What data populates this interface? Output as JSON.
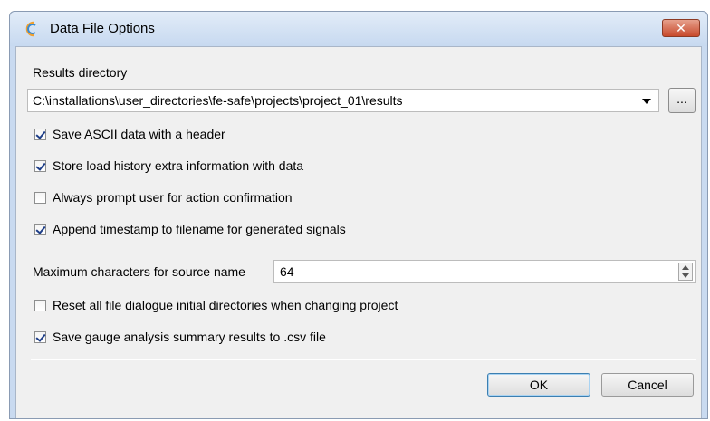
{
  "window": {
    "title": "Data File Options",
    "close_label": "✕"
  },
  "results_directory": {
    "label": "Results directory",
    "value": "C:\\installations\\user_directories\\fe-safe\\projects\\project_01\\results",
    "browse_label": "..."
  },
  "options": [
    {
      "label": "Save ASCII data with a header",
      "checked": true
    },
    {
      "label": "Store load history extra information with data",
      "checked": true
    },
    {
      "label": "Always prompt user for action confirmation",
      "checked": false
    },
    {
      "label": "Append timestamp to filename for generated signals",
      "checked": true
    }
  ],
  "max_chars": {
    "label": "Maximum characters for source name",
    "value": "64"
  },
  "options2": [
    {
      "label": "Reset all file dialogue initial directories when changing project",
      "checked": false
    },
    {
      "label": "Save gauge analysis summary results to .csv file",
      "checked": true
    }
  ],
  "buttons": {
    "ok": "OK",
    "cancel": "Cancel"
  }
}
